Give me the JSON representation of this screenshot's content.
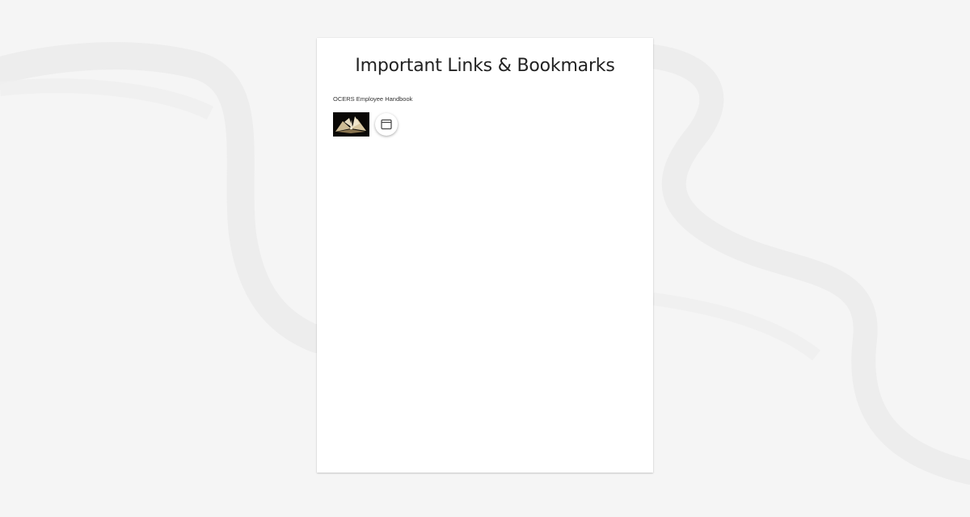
{
  "page": {
    "title": "Important Links & Bookmarks"
  },
  "links": [
    {
      "label": "OCERS Employee Handbook",
      "thumbnail_icon": "open-book-image",
      "action_icon": "browser-window-icon"
    }
  ]
}
